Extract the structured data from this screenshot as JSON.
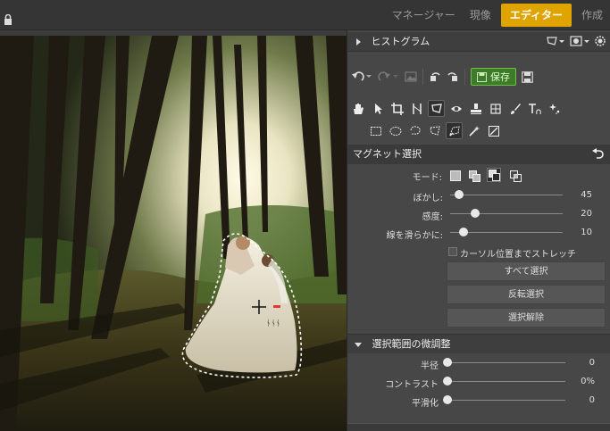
{
  "topbar": {
    "tabs": [
      {
        "label": "マネージャー"
      },
      {
        "label": "現像"
      },
      {
        "label": "エディター"
      },
      {
        "label": "作成"
      }
    ]
  },
  "histogram": {
    "title": "ヒストグラム"
  },
  "toolbar": {
    "save_label": "保存"
  },
  "magnet": {
    "title": "マグネット選択",
    "mode_label": "モード:",
    "sliders": [
      {
        "label": "ぼかし:",
        "value": "45",
        "fraction": 0.08
      },
      {
        "label": "感度:",
        "value": "20",
        "fraction": 0.22
      },
      {
        "label": "線を滑らかに:",
        "value": "10",
        "fraction": 0.12
      }
    ],
    "stretch_label": "カーソル位置までストレッチ",
    "buttons": [
      "すべて選択",
      "反転選択",
      "選択解除"
    ]
  },
  "fine": {
    "title": "選択範囲の微調整",
    "sliders": [
      {
        "label": "半径",
        "value": "0",
        "fraction": 0
      },
      {
        "label": "コントラスト",
        "value": "0%",
        "fraction": 0
      },
      {
        "label": "平滑化",
        "value": "0",
        "fraction": 0
      }
    ]
  },
  "colors": {
    "accent": "#e0a400",
    "save": "#3d7a2a",
    "panel": "#474747"
  }
}
